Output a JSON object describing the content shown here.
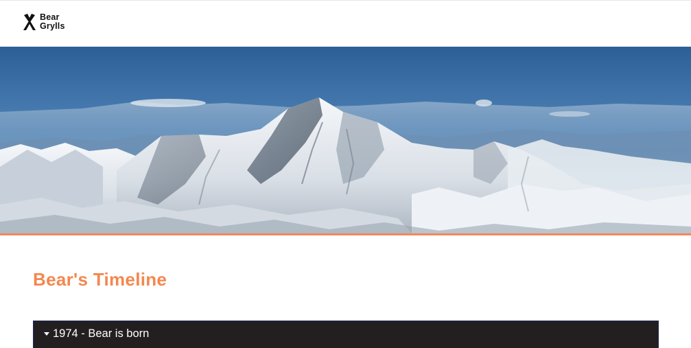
{
  "header": {
    "logo": {
      "line1": "Bear",
      "line2": "Grylls",
      "mark_icon": "crossed-blades-icon"
    }
  },
  "hero": {
    "image_subject": "snow-capped-mountain-range",
    "accent_color": "#f2895a"
  },
  "timeline": {
    "title": "Bear's Timeline",
    "title_color": "#f4874f",
    "items": [
      {
        "label": "1974 - Bear is born",
        "expanded": false,
        "icon": "caret-down-icon"
      }
    ]
  }
}
